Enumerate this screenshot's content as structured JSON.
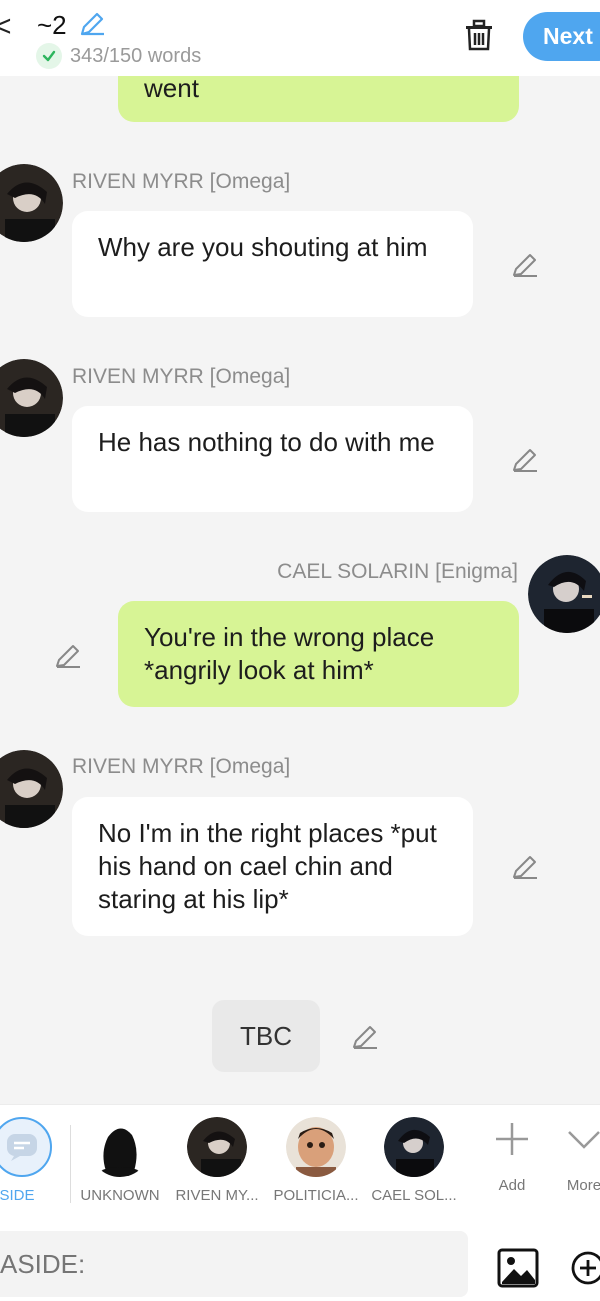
{
  "header": {
    "back_glyph": "<",
    "title": "~2",
    "word_count": "343/150 words",
    "next_label": "Next"
  },
  "messages": [
    {
      "side": "right",
      "sender": "",
      "text": "went"
    },
    {
      "side": "left",
      "sender": "RIVEN MYRR [Omega]",
      "text": "Why are you shouting at him"
    },
    {
      "side": "left",
      "sender": "RIVEN MYRR [Omega]",
      "text": "He has nothing to do with me"
    },
    {
      "side": "right",
      "sender": "CAEL SOLARIN [Enigma]",
      "text": "You're in the wrong place *angrily look at him*"
    },
    {
      "side": "left",
      "sender": "RIVEN MYRR [Omega]",
      "text": "No I'm in the right places *put his hand on cael chin and staring at his lip*"
    }
  ],
  "tbc": "TBC",
  "characters": [
    {
      "label": "ASIDE",
      "selected": true
    },
    {
      "label": "UNKNOWN"
    },
    {
      "label": "RIVEN MY..."
    },
    {
      "label": "POLITICIA..."
    },
    {
      "label": "CAEL SOL..."
    }
  ],
  "actions": {
    "add_label": "Add",
    "more_label": "More"
  },
  "composer": {
    "placeholder": "ASIDE:"
  },
  "colors": {
    "accent": "#4fa6ef",
    "right_bubble": "#d7f495",
    "left_bubble": "#ffffff",
    "background": "#f4f4f4"
  }
}
